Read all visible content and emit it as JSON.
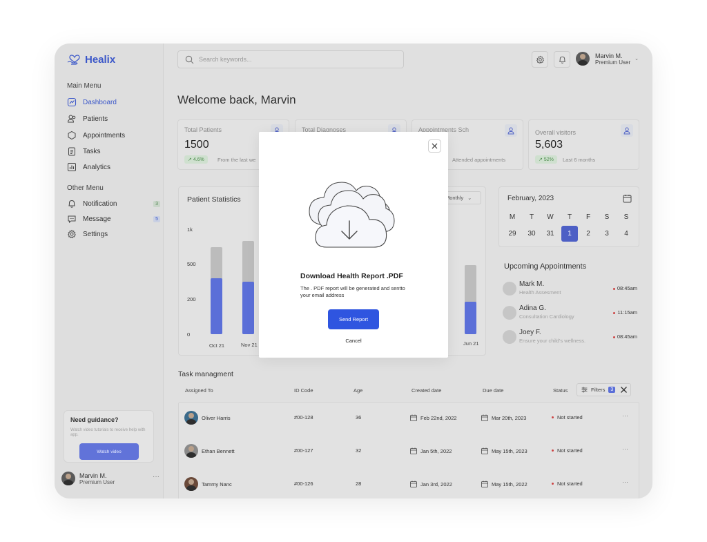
{
  "brand": {
    "name": "Healix",
    "accent": "#3b57c9"
  },
  "sidebar": {
    "main_menu_label": "Main Menu",
    "main_items": [
      {
        "label": "Dashboard",
        "icon": "dashboard-icon",
        "active": true
      },
      {
        "label": "Patients",
        "icon": "users-icon"
      },
      {
        "label": "Appointments",
        "icon": "hexagon-icon"
      },
      {
        "label": "Tasks",
        "icon": "clipboard-icon"
      },
      {
        "label": "Analytics",
        "icon": "chart-icon"
      }
    ],
    "other_menu_label": "Other Menu",
    "other_items": [
      {
        "label": "Notification",
        "icon": "bell-icon",
        "badge": "3"
      },
      {
        "label": "Message",
        "icon": "message-icon",
        "badge": "5"
      },
      {
        "label": "Settings",
        "icon": "gear-icon"
      }
    ],
    "guide": {
      "title": "Need guidance?",
      "text": "Watch video tutorials to receive help with app.",
      "button": "Watch video"
    },
    "user": {
      "name": "Marvin M.",
      "role": "Premium User",
      "more": "···"
    }
  },
  "topbar": {
    "search_placeholder": "Search keywords...",
    "user": {
      "name": "Marvin M.",
      "role": "Premium User"
    }
  },
  "welcome": "Welcome back, Marvin",
  "stats": [
    {
      "title": "Total Patients",
      "value": "1500",
      "change": "4.6%",
      "note": "From the last we"
    },
    {
      "title": "Total Diagnoses",
      "value": "",
      "change": "",
      "note": ""
    },
    {
      "title": "Appointments Sch",
      "value": "",
      "change": "",
      "note": "Attended appointments"
    },
    {
      "title": "Overall visitors",
      "value": "5,603",
      "change": "52%",
      "note": "Last 6 months"
    }
  ],
  "patient_statistics": {
    "title": "Patient Statistics",
    "range": "Monthly",
    "y_ticks": [
      "1k",
      "500",
      "200",
      "0"
    ]
  },
  "chart_data": {
    "type": "bar",
    "title": "Patient Statistics",
    "categories": [
      "Oct 21",
      "Nov 21",
      "Jun 21"
    ],
    "series": [
      {
        "values": [
          830,
          890,
          660
        ]
      },
      {
        "values": [
          530,
          500,
          310
        ]
      }
    ],
    "ylim": [
      0,
      1000
    ],
    "note": "Stacked-style bars: total (grey) with blue portion; middle months hidden behind modal"
  },
  "calendar": {
    "month": "February, 2023",
    "weekdays": [
      "M",
      "T",
      "W",
      "T",
      "F",
      "S",
      "S"
    ],
    "days": [
      "29",
      "30",
      "31",
      "1",
      "2",
      "3",
      "4"
    ],
    "selected": "1"
  },
  "upcoming": {
    "title": "Upcoming Appointments",
    "items": [
      {
        "name": "Mark M.",
        "desc": "Health Assesment",
        "time": "08:45am"
      },
      {
        "name": "Adina G.",
        "desc": "Consultation Cardiology",
        "time": "11:15am"
      },
      {
        "name": "Joey F.",
        "desc": "Ensure your child's wellness.",
        "time": "08:45am"
      }
    ]
  },
  "tasks": {
    "title": "Task managment",
    "columns": [
      "Assigned To",
      "ID Code",
      "Age",
      "Created date",
      "Due date",
      "Status"
    ],
    "filters_label": "Filters",
    "filters_count": "3",
    "rows": [
      {
        "name": "Oliver Harris",
        "id": "#00-128",
        "age": "36",
        "created": "Feb 22nd, 2022",
        "due": "Mar 20th, 2023",
        "status": "Not started"
      },
      {
        "name": "Ethan Bennett",
        "id": "#00-127",
        "age": "32",
        "created": "Jan 5th, 2022",
        "due": "May 15th, 2023",
        "status": "Not started"
      },
      {
        "name": "Tammy Nanc",
        "id": "#00-126",
        "age": "28",
        "created": "Jan 3rd, 2022",
        "due": "May 15th, 2022",
        "status": "Not started"
      }
    ]
  },
  "modal": {
    "title": "Download Health Report .PDF",
    "description": "The . PDF report will be generated and sentto your email address",
    "primary": "Send Report",
    "secondary": "Cancel",
    "primary_color": "#2f55e0"
  }
}
